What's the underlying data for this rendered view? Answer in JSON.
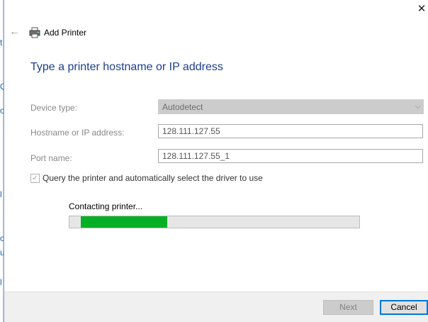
{
  "window": {
    "title": "Add Printer",
    "close_glyph": "✕",
    "back_glyph": "←"
  },
  "main": {
    "heading": "Type a printer hostname or IP address",
    "fields": {
      "device_type": {
        "label": "Device type:",
        "value": "Autodetect",
        "chevron": "⌵"
      },
      "hostname": {
        "label": "Hostname or IP address:",
        "value": "128.111.127.55"
      },
      "port_name": {
        "label": "Port name:",
        "value": "128.111.127.55_1"
      }
    },
    "query_checkbox": {
      "label": "Query the printer and automatically select the driver to use",
      "checked": true,
      "glyph": "✓"
    },
    "progress": {
      "status": "Contacting printer...",
      "fraction": 0.31
    }
  },
  "footer": {
    "next_label": "Next",
    "cancel_label": "Cancel"
  },
  "behind_window": {
    "glyphs": [
      "t",
      "Q",
      "o",
      "l",
      "o",
      "u",
      "l"
    ]
  },
  "colors": {
    "accent": "#0078d7",
    "heading": "#1b3f8f",
    "progress": "#06b025"
  }
}
